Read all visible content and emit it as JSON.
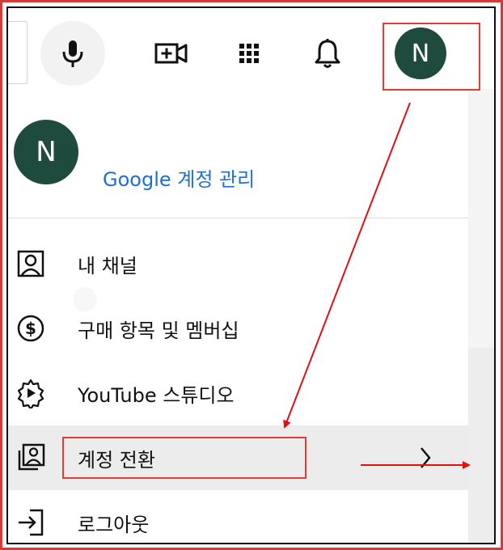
{
  "header": {
    "avatar_initial": "N"
  },
  "account": {
    "avatar_initial": "N",
    "manage_link": "Google 계정 관리"
  },
  "menu": [
    {
      "label": "내 채널",
      "icon": "person-icon"
    },
    {
      "label": "구매 항목 및 멤버십",
      "icon": "dollar-icon"
    },
    {
      "label": "YouTube 스튜디오",
      "icon": "studio-gear-icon"
    },
    {
      "label": "계정 전환",
      "icon": "switch-account-icon"
    },
    {
      "label": "로그아웃",
      "icon": "sign-out-icon"
    }
  ],
  "colors": {
    "annotation_red": "#e53b35",
    "avatar_bg": "#1f4a3e",
    "link_blue": "#1f6fd0"
  }
}
